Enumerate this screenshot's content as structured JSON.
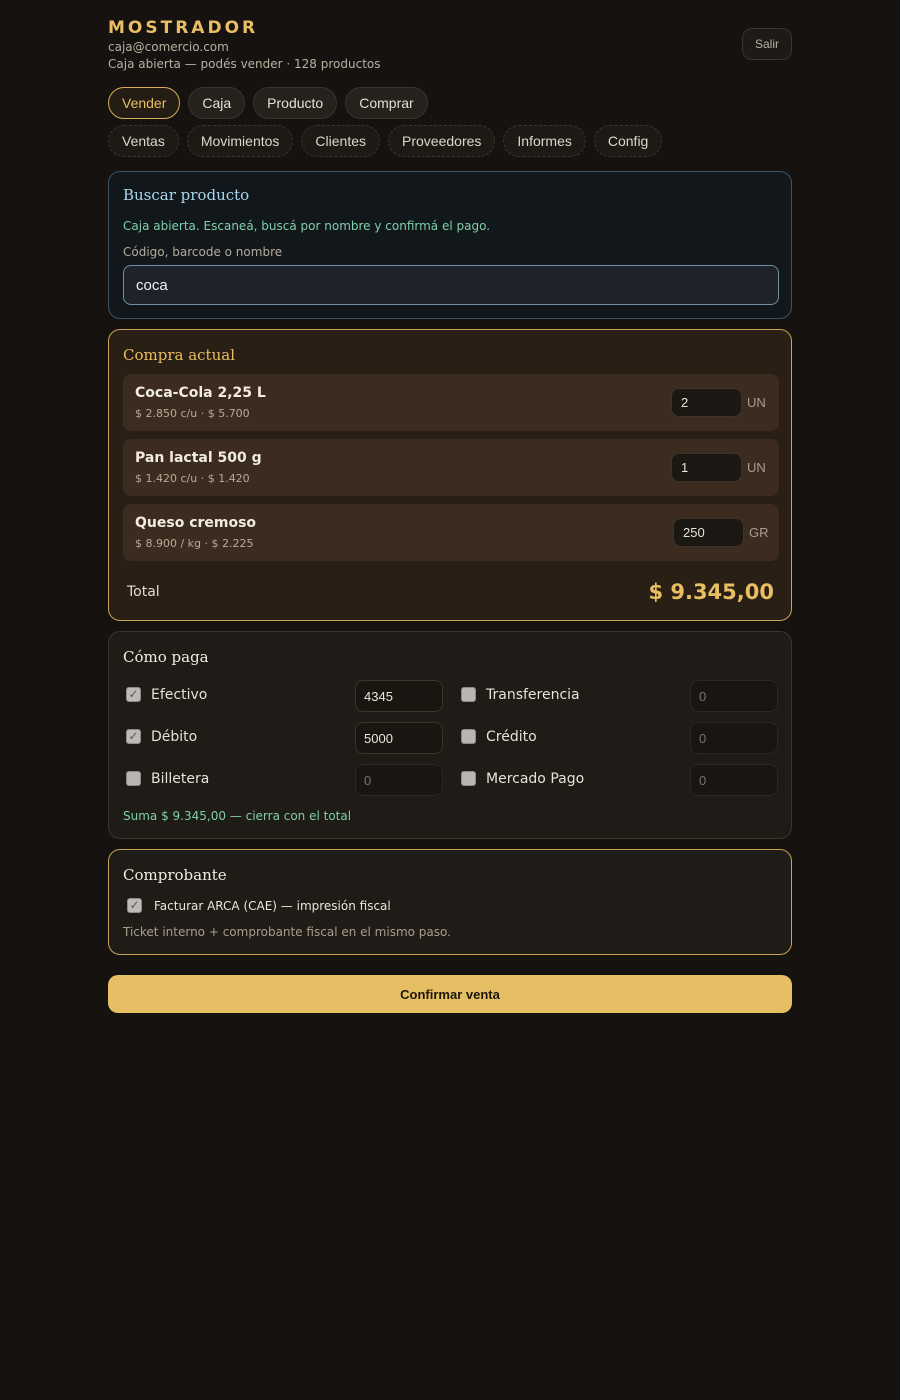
{
  "header": {
    "brand": "MOSTRADOR",
    "email": "caja@comercio.com",
    "status": "Caja abierta — podés vender · 128 productos",
    "logout_label": "Salir"
  },
  "tabs_primary": [
    "Vender",
    "Caja",
    "Producto",
    "Comprar"
  ],
  "tabs_secondary": [
    "Ventas",
    "Movimientos",
    "Clientes",
    "Proveedores",
    "Informes",
    "Config"
  ],
  "search": {
    "title": "Buscar producto",
    "hint": "Caja abierta. Escaneá, buscá por nombre y confirmá el pago.",
    "label": "Código, barcode o nombre",
    "value": "coca"
  },
  "cart": {
    "title": "Compra actual",
    "items": [
      {
        "name": "Coca-Cola 2,25 L",
        "detail": "$ 2.850 c/u · $ 5.700",
        "qty": "2",
        "unit": "UN"
      },
      {
        "name": "Pan lactal 500 g",
        "detail": "$ 1.420 c/u · $ 1.420",
        "qty": "1",
        "unit": "UN"
      },
      {
        "name": "Queso cremoso",
        "detail": "$ 8.900 / kg · $ 2.225",
        "qty": "250",
        "unit": "GR"
      }
    ],
    "total_label": "Total",
    "total_value": "$ 9.345,00"
  },
  "payment": {
    "title": "Cómo paga",
    "methods": [
      {
        "label": "Efectivo",
        "checked": true,
        "amount": "4345"
      },
      {
        "label": "Transferencia",
        "checked": false,
        "amount": "0"
      },
      {
        "label": "Débito",
        "checked": true,
        "amount": "5000"
      },
      {
        "label": "Crédito",
        "checked": false,
        "amount": "0"
      },
      {
        "label": "Billetera",
        "checked": false,
        "amount": "0"
      },
      {
        "label": "Mercado Pago",
        "checked": false,
        "amount": "0"
      }
    ],
    "sum_text": "Suma $ 9.345,00 — cierra con el total"
  },
  "receipt": {
    "title": "Comprobante",
    "checkbox_label": "Facturar ARCA (CAE) — impresión fiscal",
    "checked": true,
    "note": "Ticket interno + comprobante fiscal en el mismo paso."
  },
  "confirm_label": "Confirmar venta",
  "colors": {
    "accent": "#e9be62",
    "info": "#a9d7ee",
    "success": "#7fcfaa",
    "background": "#15120f"
  }
}
